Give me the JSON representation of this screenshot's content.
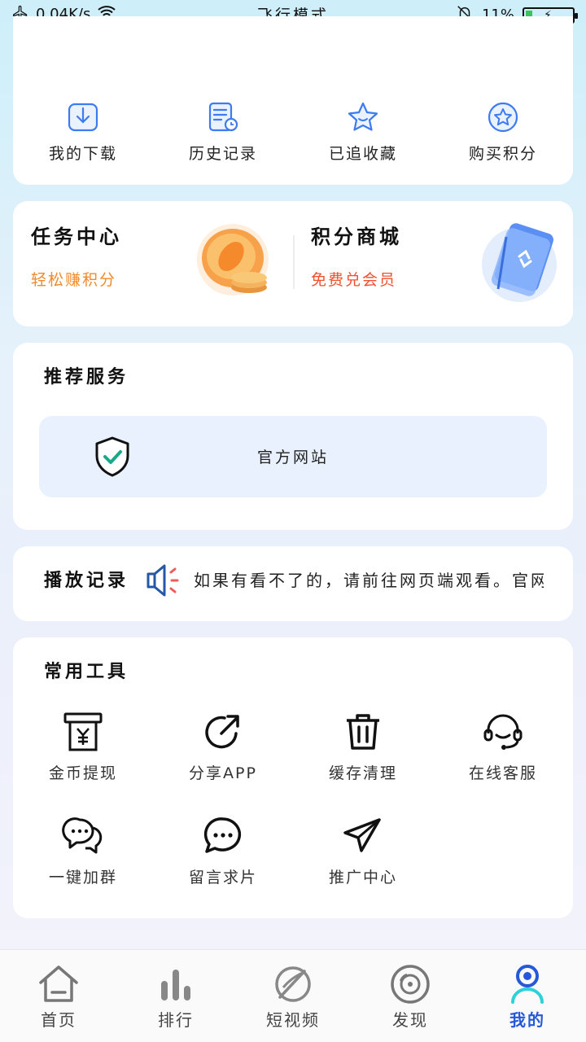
{
  "status_bar": {
    "speed": "0.04K/s",
    "mode": "飞行模式",
    "battery": "11%"
  },
  "quick_actions": [
    {
      "label": "我的下载",
      "icon": "download-icon"
    },
    {
      "label": "历史记录",
      "icon": "history-icon"
    },
    {
      "label": "已追收藏",
      "icon": "star-icon"
    },
    {
      "label": "购买积分",
      "icon": "star-circle-icon"
    }
  ],
  "task_center": {
    "title": "任务中心",
    "subtitle": "轻松赚积分",
    "subtitle_color": "#f08a2a"
  },
  "points_mall": {
    "title": "积分商城",
    "subtitle": "免费兑会员",
    "subtitle_color": "#f0502e"
  },
  "recommended": {
    "title": "推荐服务",
    "item_label": "官方网站"
  },
  "play_record": {
    "title": "播放记录",
    "notice": "如果有看不了的，请前往网页端观看。官网"
  },
  "tools": {
    "title": "常用工具",
    "items": [
      {
        "label": "金币提现",
        "icon": "coin-withdraw-icon"
      },
      {
        "label": "分享APP",
        "icon": "share-icon"
      },
      {
        "label": "缓存清理",
        "icon": "trash-icon"
      },
      {
        "label": "在线客服",
        "icon": "headset-icon"
      },
      {
        "label": "一键加群",
        "icon": "group-chat-icon"
      },
      {
        "label": "留言求片",
        "icon": "message-icon"
      },
      {
        "label": "推广中心",
        "icon": "send-icon"
      }
    ]
  },
  "tabs": [
    {
      "label": "首页",
      "icon": "home-icon",
      "active": false
    },
    {
      "label": "排行",
      "icon": "ranking-icon",
      "active": false
    },
    {
      "label": "短视频",
      "icon": "short-video-icon",
      "active": false
    },
    {
      "label": "发现",
      "icon": "discover-icon",
      "active": false
    },
    {
      "label": "我的",
      "icon": "profile-icon",
      "active": true
    }
  ],
  "colors": {
    "accent": "#2659d8",
    "icon_blue": "#3d7bf0",
    "card": "#ffffff"
  }
}
